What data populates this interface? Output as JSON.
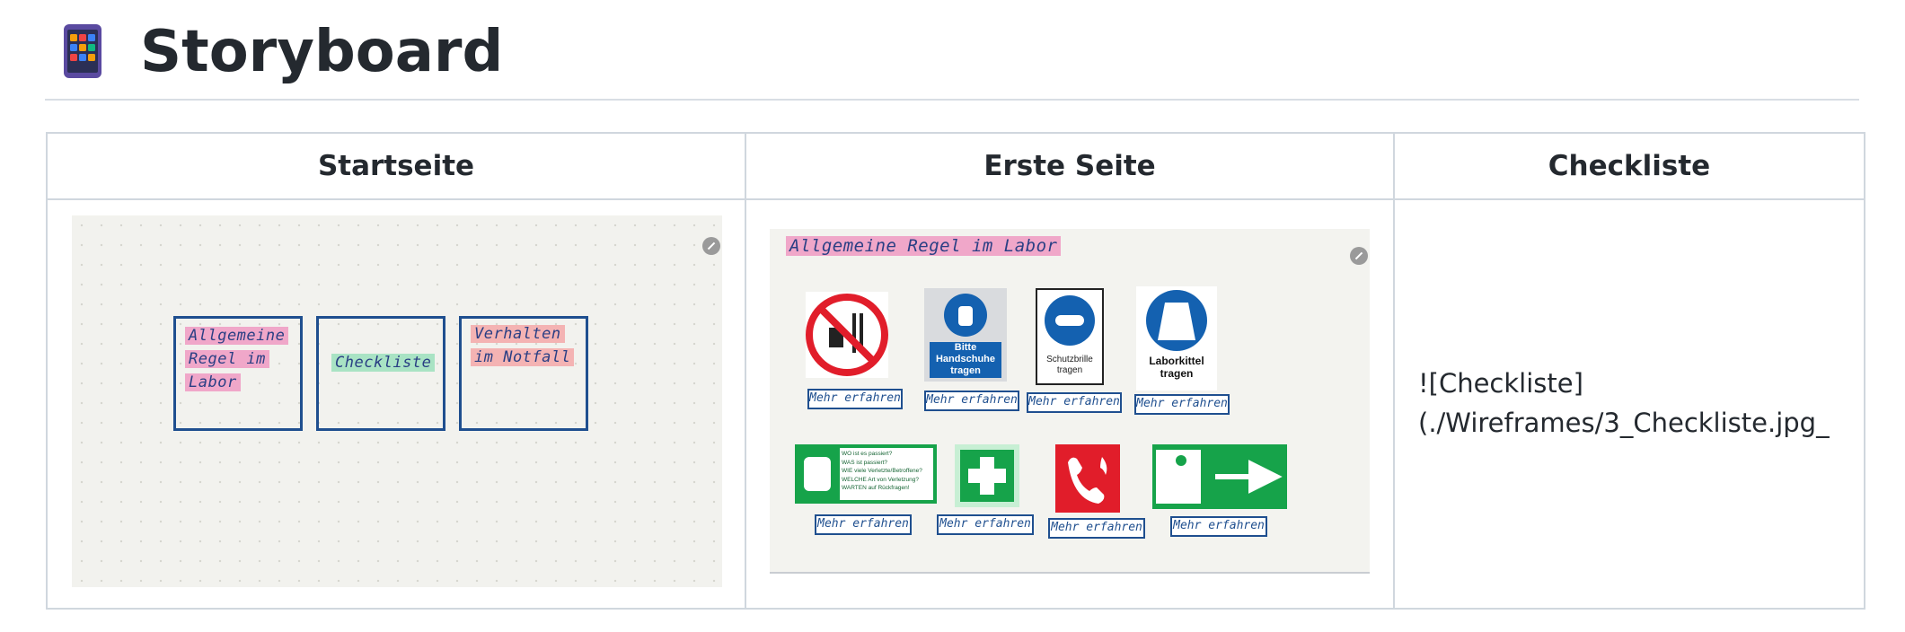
{
  "page": {
    "title": "Storyboard",
    "icon": "phone-app-icon"
  },
  "table": {
    "headers": [
      "Startseite",
      "Erste Seite",
      "Checkliste"
    ]
  },
  "startseite": {
    "boxes": [
      {
        "lines": [
          "Allgemeine",
          "Regel im",
          "Labor"
        ],
        "highlight": "#f0a7c9"
      },
      {
        "lines": [
          "Checkliste"
        ],
        "highlight": "#a9e3c4"
      },
      {
        "lines": [
          "Verhalten",
          "im Notfall"
        ],
        "highlight": "#f4b3b3"
      }
    ]
  },
  "erste_seite": {
    "heading": "Allgemeine Regel im Labor",
    "more_label": "Mehr erfahren",
    "signs": {
      "gloves": "Bitte Handschuhe tragen",
      "goggles": "Schutzbrille tragen",
      "labcoat": "Laborkittel tragen",
      "first_aid_lines": [
        "WO ist es passiert?",
        "WAS ist passiert?",
        "WIE viele Verletzte/Betroffene?",
        "WELCHE Art von Verletzung?",
        "WARTEN auf Rückfragen!"
      ]
    }
  },
  "checkliste": {
    "text_line1": "![Checkliste]",
    "text_line2": "(./Wireframes/3_Checkliste.jpg_"
  },
  "colors": {
    "border": "#d0d7de",
    "ink": "#1f4f8f",
    "sign_blue": "#1461b0",
    "sign_green": "#16a34a",
    "sign_red": "#e11d2a"
  }
}
